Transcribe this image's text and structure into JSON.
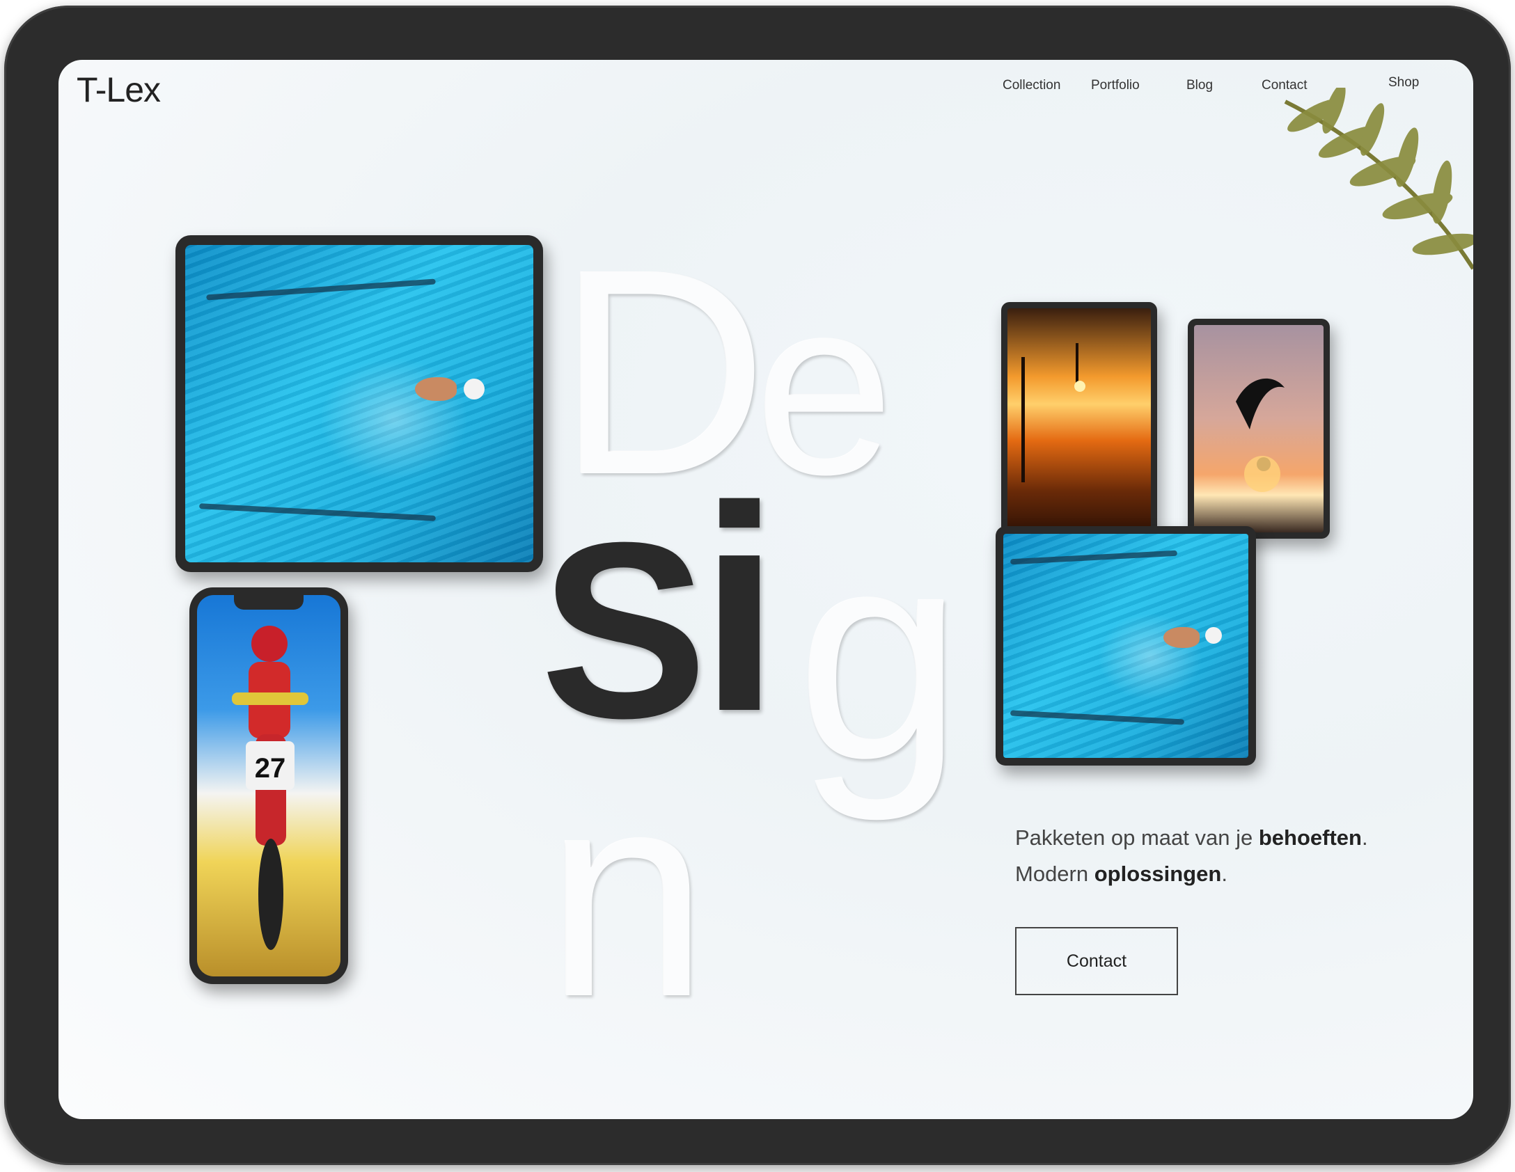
{
  "header": {
    "logo": "T-Lex",
    "nav": [
      "Collection",
      "Portfolio",
      "Blog",
      "Contact",
      "Shop"
    ]
  },
  "hero": {
    "letters": {
      "D": "D",
      "e": "e",
      "S": "S",
      "i": "i",
      "g": "g",
      "n": "n"
    },
    "tagline": {
      "part1": "Pakketen op maat van je ",
      "part1_bold": "behoeften",
      "part1_end": ".",
      "part2": "Modern ",
      "part2_bold": "oplossingen",
      "part2_end": "."
    },
    "cta_label": "Contact"
  },
  "colors": {
    "frame": "#2c2c2c",
    "text_dark": "#222222",
    "water": "#25c3ee",
    "sunset": "#f39a2d"
  },
  "icons": [
    "fern-leaf-icon"
  ]
}
